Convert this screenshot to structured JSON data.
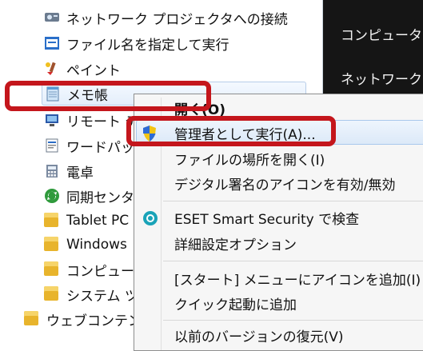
{
  "start_menu": {
    "programs": [
      {
        "label": "ネットワーク プロジェクタへの接続",
        "icon": "projector-icon"
      },
      {
        "label": "ファイル名を指定して実行",
        "icon": "run-icon"
      },
      {
        "label": "ペイント",
        "icon": "paint-icon"
      },
      {
        "label": "メモ帳",
        "icon": "notepad-icon"
      },
      {
        "label": "リモート デ",
        "icon": "remote-desktop-icon"
      },
      {
        "label": "ワードパッ",
        "icon": "wordpad-icon"
      },
      {
        "label": "電卓",
        "icon": "calculator-icon"
      },
      {
        "label": "同期センタ",
        "icon": "sync-center-icon"
      },
      {
        "label": "Tablet PC",
        "icon": "folder-icon"
      },
      {
        "label": "Windows",
        "icon": "folder-icon"
      },
      {
        "label": "コンピュー",
        "icon": "folder-icon"
      },
      {
        "label": "システム ツ",
        "icon": "folder-icon"
      },
      {
        "label": "ウェブコンテン",
        "icon": "folder-icon"
      }
    ],
    "right_pane": {
      "computer": "コンピュータ",
      "network": "ネットワーク"
    }
  },
  "context_menu": {
    "items": [
      {
        "label": "開く(O)",
        "bold": true
      },
      {
        "label": "管理者として実行(A)...",
        "icon": "uac-shield-icon"
      },
      {
        "label": "ファイルの場所を開く(I)"
      },
      {
        "label": "デジタル署名のアイコンを有効/無効"
      },
      {
        "label": "ESET Smart Security で検查",
        "icon": "eset-icon"
      },
      {
        "label": "詳細設定オプション"
      },
      {
        "label": "[スタート] メニューにアイコンを追加(I)"
      },
      {
        "label": "クイック起動に追加"
      },
      {
        "label": "以前のバージョンの復元(V)"
      }
    ]
  },
  "colors": {
    "highlight_red": "#c4161c",
    "right_pane_bg": "#151515"
  }
}
